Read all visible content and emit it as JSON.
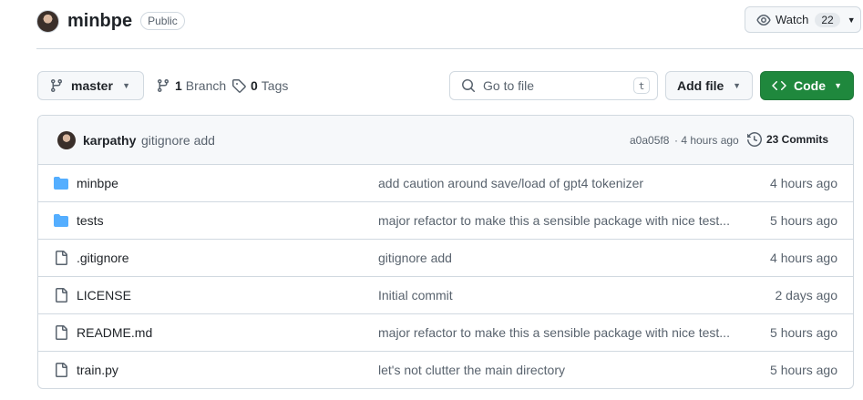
{
  "repo": {
    "name": "minbpe",
    "visibility": "Public",
    "watch_label": "Watch",
    "watch_count": "22"
  },
  "toolbar": {
    "branch_name": "master",
    "branches_count": "1",
    "branches_label": "Branch",
    "tags_count": "0",
    "tags_label": "Tags",
    "search_placeholder": "Go to file",
    "search_shortcut": "t",
    "add_file_label": "Add file",
    "code_label": "Code"
  },
  "latest_commit": {
    "author": "karpathy",
    "message": "gitignore add",
    "hash": "a0a05f8",
    "time": "· 4 hours ago",
    "commits_label": "23 Commits"
  },
  "files": [
    {
      "name": "minbpe",
      "type": "folder",
      "message": "add caution around save/load of gpt4 tokenizer",
      "time": "4 hours ago"
    },
    {
      "name": "tests",
      "type": "folder",
      "message": "major refactor to make this a sensible package with nice test...",
      "time": "5 hours ago"
    },
    {
      "name": ".gitignore",
      "type": "file",
      "message": "gitignore add",
      "time": "4 hours ago"
    },
    {
      "name": "LICENSE",
      "type": "file",
      "message": "Initial commit",
      "time": "2 days ago"
    },
    {
      "name": "README.md",
      "type": "file",
      "message": "major refactor to make this a sensible package with nice test...",
      "time": "5 hours ago"
    },
    {
      "name": "train.py",
      "type": "file",
      "message": "let's not clutter the main directory",
      "time": "5 hours ago"
    }
  ],
  "icons": {
    "folder": "folder-icon",
    "file": "file-icon",
    "branch": "git-branch-icon",
    "tag": "tag-icon",
    "search": "search-icon",
    "eye": "eye-icon",
    "history": "history-icon",
    "code": "code-icon"
  },
  "colors": {
    "code_button": "#1f883d",
    "folder": "#54aeff",
    "border": "#d1d9e0",
    "muted_text": "#59636e"
  }
}
